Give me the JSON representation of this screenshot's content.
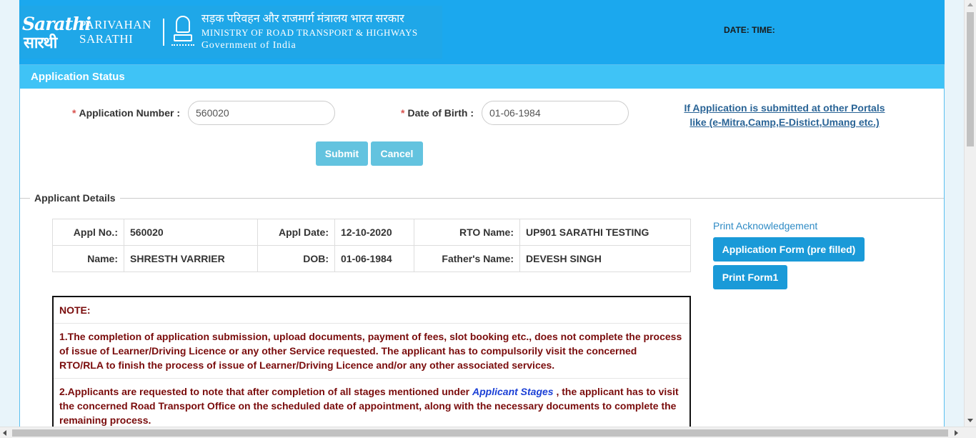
{
  "header": {
    "logo_line1": "Sarathi",
    "logo_line2": "सारथी",
    "brand_line1": "PARIVAHAN",
    "brand_line2": "SARATHI",
    "ministry_hindi": "सड़क परिवहन और राजमार्ग मंत्रालय भारत सरकार",
    "ministry_english": "MINISTRY OF ROAD TRANSPORT & HIGHWAYS",
    "government": "Government of India",
    "datetime_label": "DATE: TIME:"
  },
  "panel": {
    "title": "Application Status"
  },
  "form": {
    "required_mark": "*",
    "app_number_label": "Application Number :",
    "app_number_value": "560020",
    "dob_label": "Date of Birth :",
    "dob_value": "01-06-1984",
    "portal_link_line1": "If Application is submitted at other Portals",
    "portal_link_line2": "like (e-Mitra,Camp,E-Distict,Umang etc.)",
    "submit_label": "Submit",
    "cancel_label": "Cancel"
  },
  "applicant": {
    "legend": "Applicant Details",
    "rows": [
      [
        {
          "key": "Appl No.:",
          "value": "560020"
        },
        {
          "key": "Appl Date:",
          "value": "12-10-2020"
        },
        {
          "key": "RTO Name:",
          "value": "UP901 SARATHI TESTING"
        }
      ],
      [
        {
          "key": "Name:",
          "value": "SHRESTH VARRIER"
        },
        {
          "key": "DOB:",
          "value": "01-06-1984"
        },
        {
          "key": "Father's Name:",
          "value": "DEVESH SINGH"
        }
      ]
    ]
  },
  "acknowledgement": {
    "title": "Print Acknowledgement",
    "app_form_button": "Application Form (pre filled)",
    "print_form1_button": "Print Form1"
  },
  "note": {
    "heading": "NOTE:",
    "point1": "1.The completion of application submission, upload documents, payment of fees, slot booking etc., does not complete the process of issue of Learner/Driving Licence or any other Service requested. The applicant has to compulsorily visit the concerned RTO/RLA to finish the process of issue of Learner/Driving Licence and/or any other associated services.",
    "point2_before": "2.Applicants are requested to note that after completion of all stages mentioned under ",
    "point2_link": "Applicant Stages",
    "point2_after": " , the applicant has to visit the concerned Road Transport Office on the scheduled date of appointment, along with the necessary documents to complete the remaining process."
  }
}
